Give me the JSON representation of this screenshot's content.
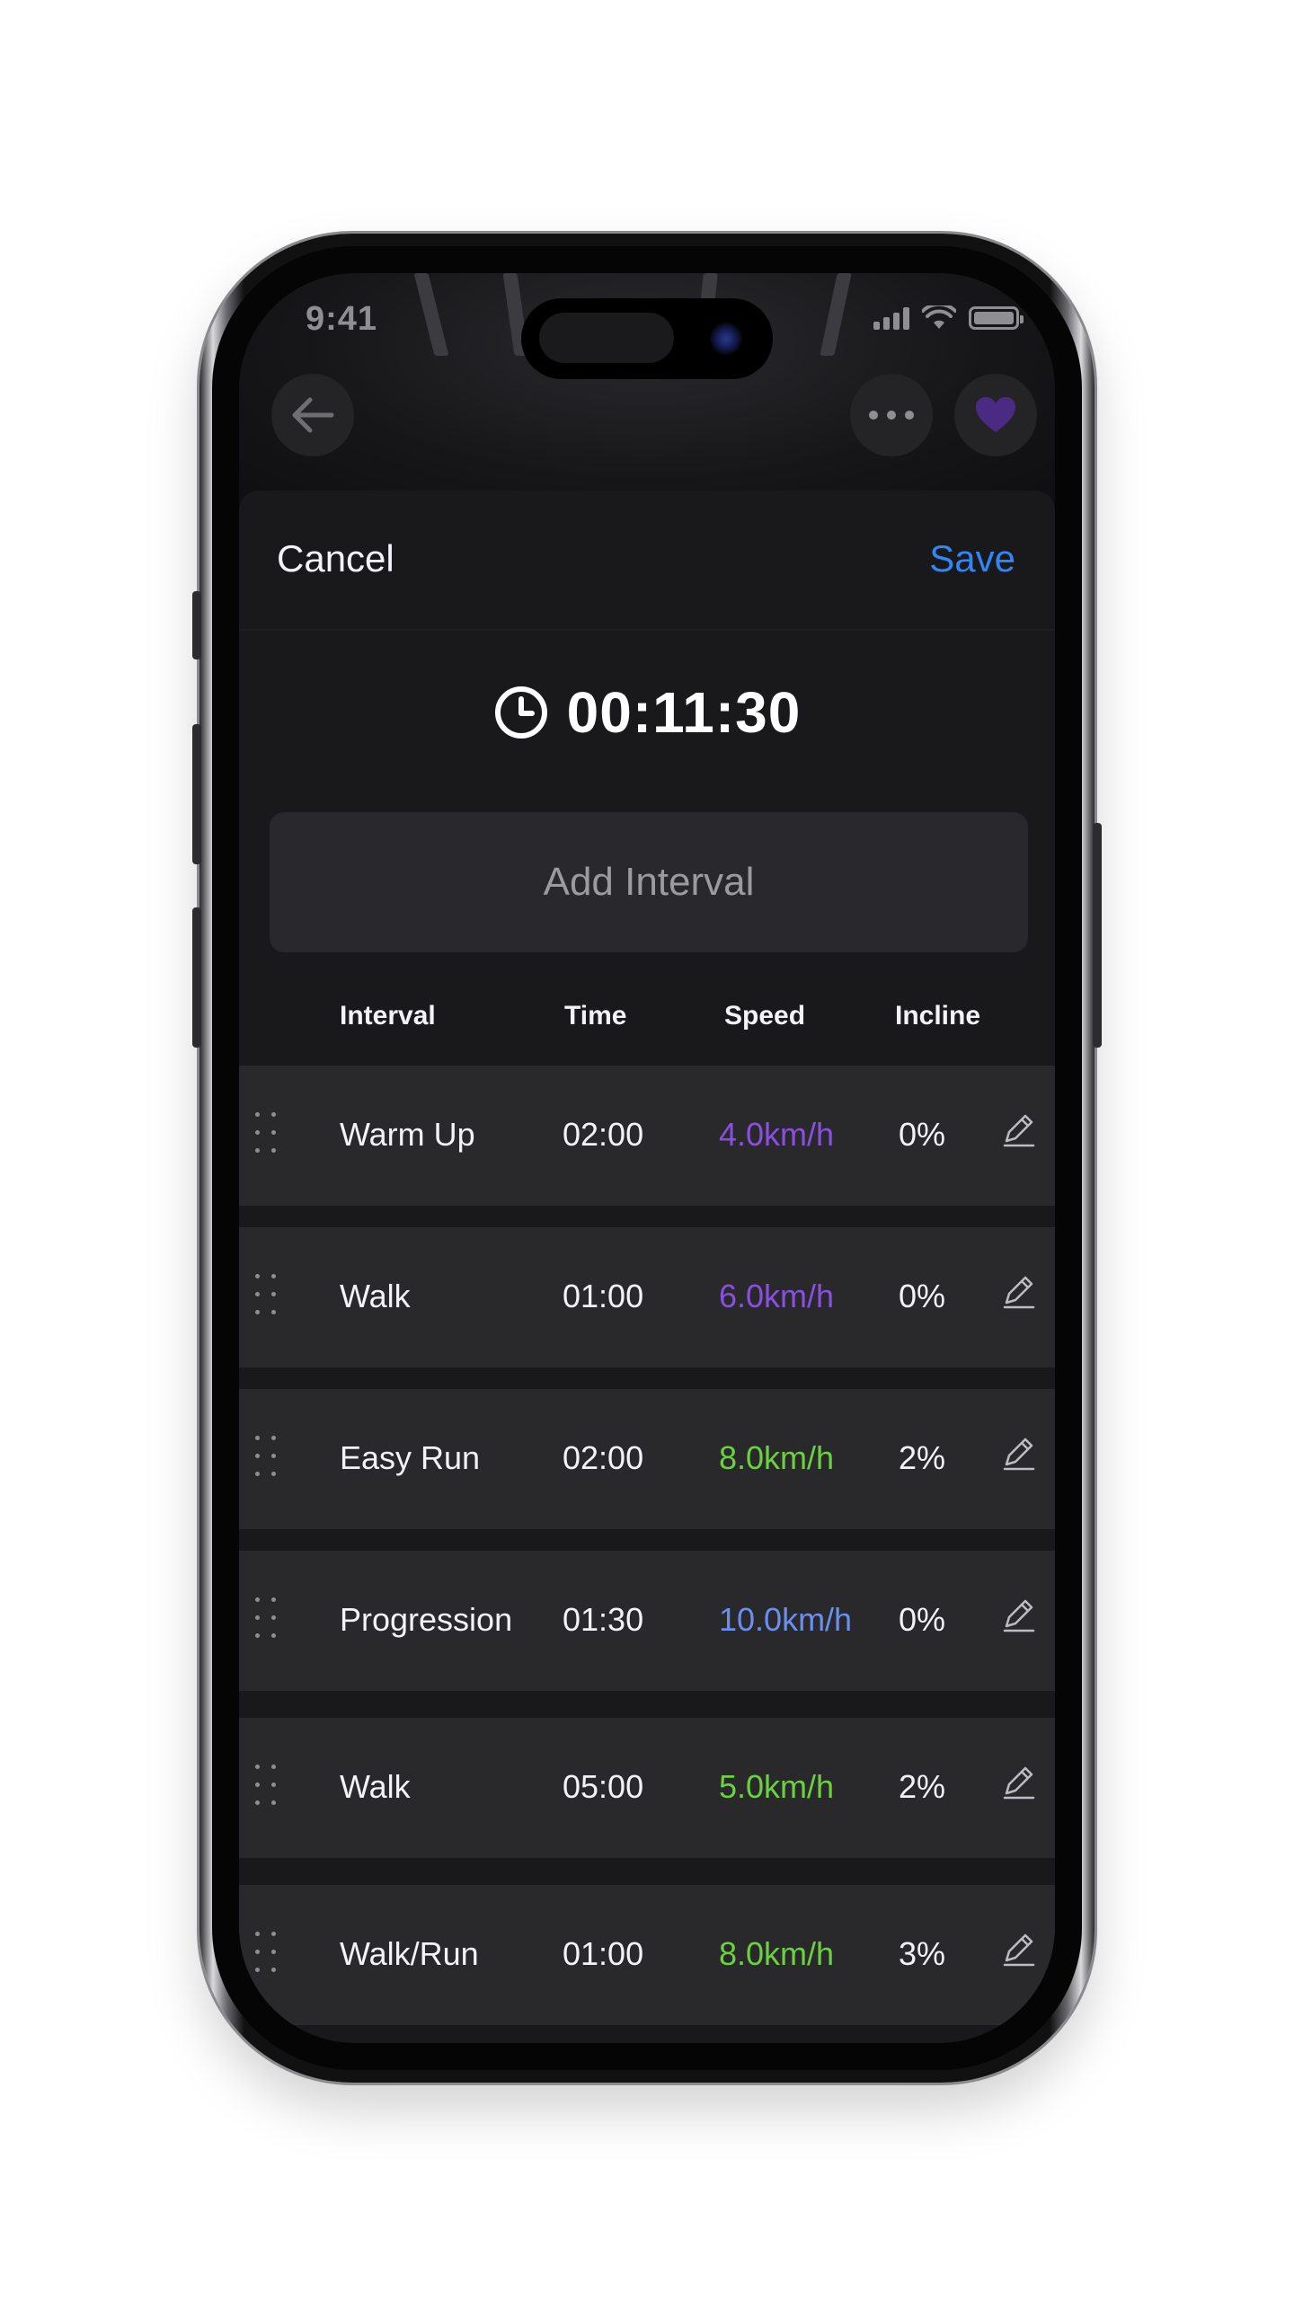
{
  "status_bar": {
    "time": "9:41"
  },
  "sheet": {
    "cancel_label": "Cancel",
    "save_label": "Save",
    "total_time": "00:11:30",
    "add_interval_label": "Add Interval"
  },
  "table": {
    "headers": {
      "interval": "Interval",
      "time": "Time",
      "speed": "Speed",
      "incline": "Incline"
    },
    "rows": [
      {
        "interval": "Warm Up",
        "time": "02:00",
        "speed": "4.0km/h",
        "speed_color": "#8a4fe0",
        "incline": "0%"
      },
      {
        "interval": "Walk",
        "time": "01:00",
        "speed": "6.0km/h",
        "speed_color": "#8a4fe0",
        "incline": "0%"
      },
      {
        "interval": "Easy Run",
        "time": "02:00",
        "speed": "8.0km/h",
        "speed_color": "#6cd13f",
        "incline": "2%"
      },
      {
        "interval": "Progression",
        "time": "01:30",
        "speed": "10.0km/h",
        "speed_color": "#6b8ff0",
        "incline": "0%"
      },
      {
        "interval": "Walk",
        "time": "05:00",
        "speed": "5.0km/h",
        "speed_color": "#6cd13f",
        "incline": "2%"
      },
      {
        "interval": "Walk/Run",
        "time": "01:00",
        "speed": "8.0km/h",
        "speed_color": "#6cd13f",
        "incline": "3%"
      }
    ]
  },
  "colors": {
    "accent": "#2f86f6",
    "favorite": "#4a2a82",
    "background": "#19191b",
    "row": "#29292c"
  }
}
